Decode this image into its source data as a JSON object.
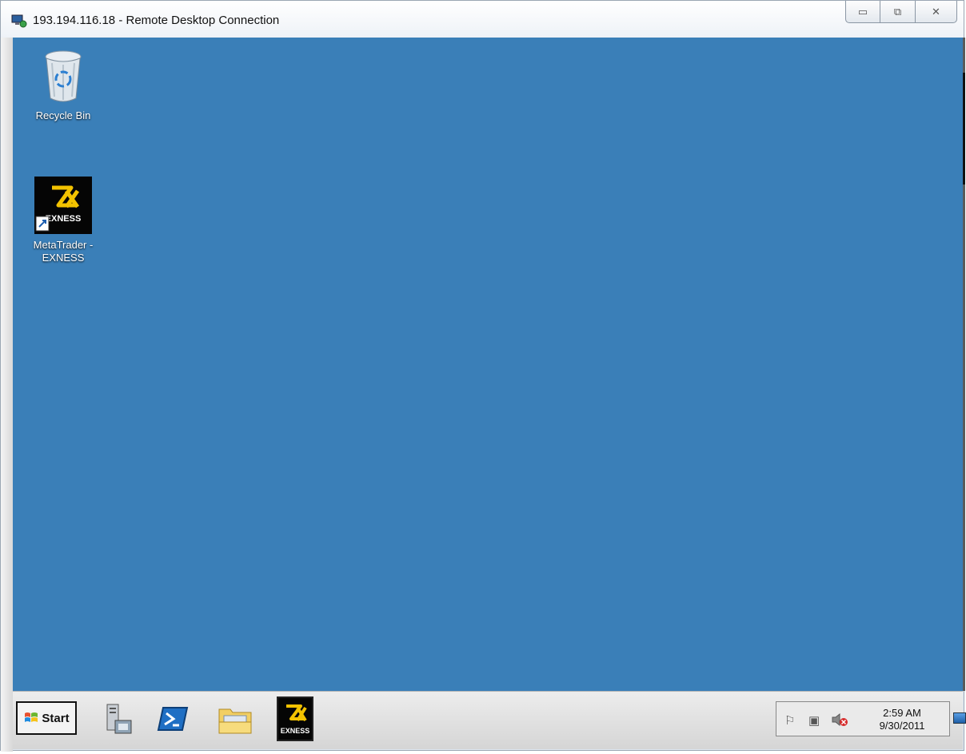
{
  "window": {
    "title": "193.194.116.18 - Remote Desktop Connection",
    "buttons": {
      "minimize": "▭",
      "restore": "⧉",
      "close": "✕"
    }
  },
  "desktop": {
    "background_color": "#3a7fb8",
    "icons": [
      {
        "label": "Recycle Bin",
        "icon": "recycle-bin-icon"
      },
      {
        "label": "MetaTrader - EXNESS",
        "icon": "exness-shortcut-icon"
      }
    ]
  },
  "taskbar": {
    "start_label": "Start",
    "pinned": [
      {
        "icon": "server-manager-icon"
      },
      {
        "icon": "powershell-icon"
      },
      {
        "icon": "file-explorer-icon"
      },
      {
        "icon": "exness-taskbar-icon",
        "text": "EXNESS"
      }
    ],
    "tray": {
      "icons": [
        "action-center-flag-icon",
        "network-icon",
        "volume-muted-icon"
      ],
      "time": "2:59 AM",
      "date": "9/30/2011"
    }
  },
  "colors": {
    "exness_gold": "#f2c200",
    "desktop_blue": "#3a7fb8"
  }
}
